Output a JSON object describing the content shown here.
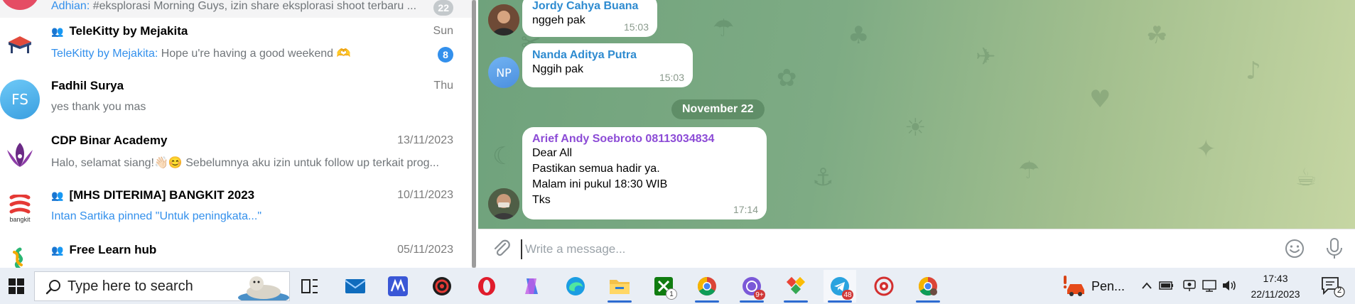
{
  "chat_list": {
    "items": [
      {
        "name": "",
        "is_group": false,
        "time": "",
        "sender": "Adhian:",
        "preview": " #eksplorasi Morning Guys, izin share eksplorasi shoot terbaru ...",
        "badge": "22",
        "badge_muted": true
      },
      {
        "name": "TeleKitty by Mejakita",
        "is_group": true,
        "time": "Sun",
        "sender": "TeleKitty by Mejakita:",
        "preview": " Hope u're having a good weekend 🫶",
        "badge": "8",
        "badge_muted": false
      },
      {
        "name": "Fadhil Surya",
        "is_group": false,
        "time": "Thu",
        "avatar_initials": "FS",
        "sender": "",
        "preview": "yes thank you mas",
        "badge": ""
      },
      {
        "name": "CDP Binar Academy",
        "is_group": false,
        "time": "13/11/2023",
        "sender": "",
        "preview": "Halo, selamat siang!👋🏻😊 Sebelumnya aku izin untuk follow up terkait prog...",
        "badge": ""
      },
      {
        "name": "[MHS DITERIMA] BANGKIT 2023",
        "is_group": true,
        "time": "10/11/2023",
        "sender": "",
        "preview": "Intan Sartika pinned \"Untuk peningkata...\"",
        "badge": "",
        "avatar_label": "bangkit"
      },
      {
        "name": "Free Learn hub",
        "is_group": true,
        "time": "05/11/2023",
        "sender": "",
        "preview": "",
        "badge": ""
      }
    ]
  },
  "messages": [
    {
      "sender": "Jordy Cahya Buana",
      "lines": [
        "nggeh pak"
      ],
      "time": "15:03"
    },
    {
      "sender": "Nanda Aditya Putra",
      "avatar_initials": "NP",
      "lines": [
        "Nggih pak"
      ],
      "time": "15:03"
    },
    {
      "sender": "Arief Andy Soebroto 08113034834",
      "lines": [
        "Dear All",
        "Pastikan semua hadir ya.",
        "Malam ini pukul 18:30 WIB",
        "Tks"
      ],
      "time": "17:14"
    }
  ],
  "date_separator": "November 22",
  "composer": {
    "placeholder": "Write a message..."
  },
  "taskbar": {
    "search_text": "Type here to search",
    "weather_text": "Pen...",
    "notification_badge": "48",
    "whatsapp_badge": "9+",
    "xbox_count": "1",
    "notif_count": "2",
    "clock_time": "17:43",
    "clock_date": "22/11/2023"
  },
  "colors": {
    "accent": "#3390ec",
    "group_sender": "#8c4bd6",
    "chat_bg": "#7eab84",
    "taskbar_bg": "#e9eef5"
  }
}
